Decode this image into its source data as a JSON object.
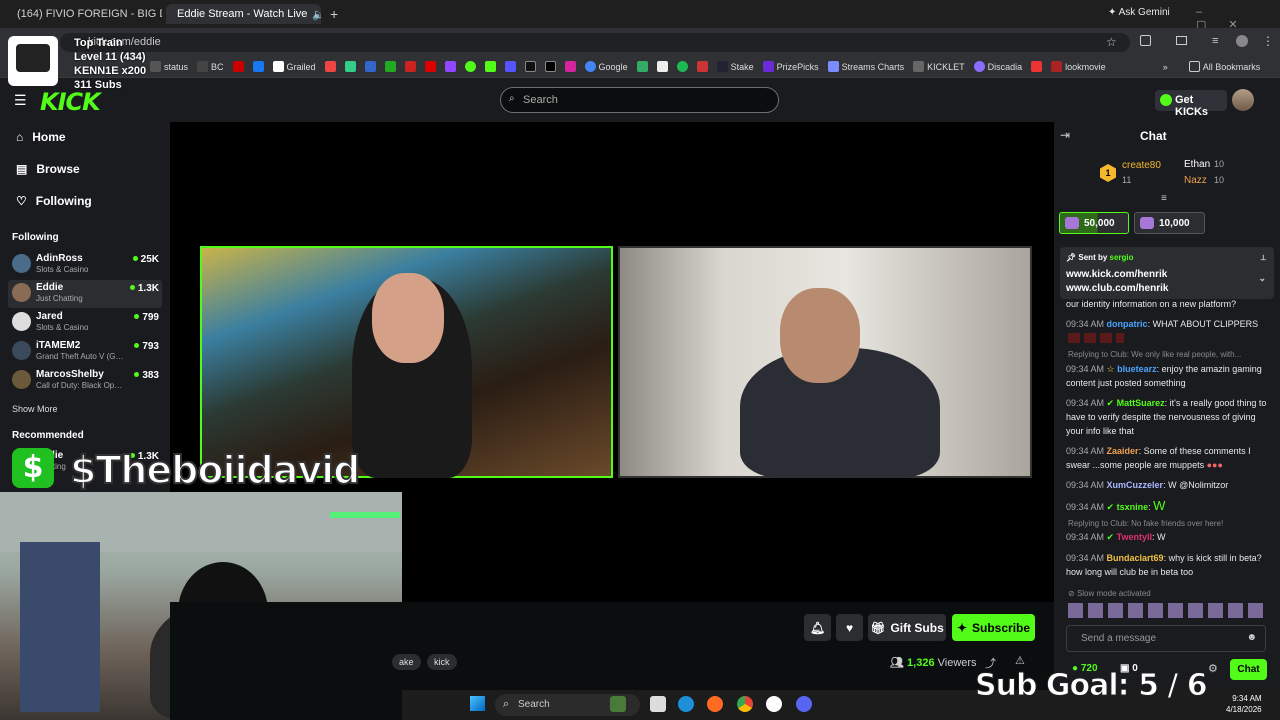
{
  "browser": {
    "tabs": [
      {
        "label": "(164) FIVIO FOREIGN - BIG DRI"
      },
      {
        "label": "Eddie Stream - Watch Live"
      }
    ],
    "ask_gemini": "Ask Gemini",
    "url": "kick.com/eddie",
    "bookmarks": [
      "status",
      "BC",
      "Grailed",
      "Google",
      "Stake",
      "PrizePicks",
      "Streams Charts",
      "KICKLET",
      "Discadia",
      "lookmovie"
    ],
    "all_bookmarks": "All Bookmarks"
  },
  "train": {
    "title": "Top Train",
    "level": "Level 11  (434)",
    "kenn": "KENN1E x200",
    "subs": "311 Subs"
  },
  "header": {
    "logo": "KICK",
    "search_placeholder": "Search",
    "get_kicks": "Get KICKs"
  },
  "sidebar": {
    "nav": [
      {
        "label": "Home"
      },
      {
        "label": "Browse"
      },
      {
        "label": "Following"
      }
    ],
    "following_heading": "Following",
    "following": [
      {
        "name": "AdinRoss",
        "category": "Slots & Casino",
        "viewers": "25K"
      },
      {
        "name": "Eddie",
        "category": "Just Chatting",
        "viewers": "1.3K"
      },
      {
        "name": "Jared",
        "category": "Slots & Casino",
        "viewers": "799"
      },
      {
        "name": "iTAMEM2",
        "category": "Grand Theft Auto V (G…",
        "viewers": "793"
      },
      {
        "name": "MarcosShelby",
        "category": "Call of Duty: Black Op…",
        "viewers": "383"
      }
    ],
    "show_more": "Show More",
    "recommended_heading": "Recommended",
    "recommended": [
      {
        "name": "Eddie",
        "category": "Chatting",
        "viewers": "1.3K"
      }
    ]
  },
  "overlay": {
    "cashtag": "$Theboiidavid",
    "dollar": "$",
    "sub_goal": "Sub Goal:  5 / 6"
  },
  "stream": {
    "gift_subs": "Gift Subs",
    "subscribe": "Subscribe",
    "tags": [
      "ake",
      "kick"
    ],
    "viewers": "1,326",
    "viewers_label": "Viewers"
  },
  "chat": {
    "title": "Chat",
    "leaderboard": {
      "first": "create80",
      "first_count": "11",
      "second": "Ethan",
      "second_count": "10",
      "third": "Nazz",
      "third_count": "10"
    },
    "goals": [
      "50,000",
      "10,000"
    ],
    "pinned": {
      "sent_by": "Sent by",
      "user": "sergio",
      "lines": [
        "www.kick.com/henrik",
        "www.club.com/henrik"
      ]
    },
    "messages": [
      {
        "time": "",
        "user": "",
        "text": "our identity information on a new platform?"
      },
      {
        "time": "09:34 AM",
        "user": "donpatric",
        "text": "WHAT ABOUT CLIPPERS"
      },
      {
        "time": "09:34 AM",
        "user": "bluetearz",
        "text": "enjoy the amazin gaming content just posted something",
        "reply": "Replying to Club: We only like real people, with..."
      },
      {
        "time": "09:34 AM",
        "user": "MattSuarez",
        "text": "it's a really good thing to have to verify despite the nervousness of giving your info like that"
      },
      {
        "time": "09:34 AM",
        "user": "Zaaider",
        "text": "Some of these comments I swear ...some people are muppets"
      },
      {
        "time": "09:34 AM",
        "user": "XumCuzzeler",
        "text": "W @Nolimitzor"
      },
      {
        "time": "09:34 AM",
        "user": "tsxnine",
        "text": ""
      },
      {
        "time": "09:34 AM",
        "user": "Twentyll",
        "text": "W",
        "reply": "Replying to Club: No fake friends over here!"
      },
      {
        "time": "09:34 AM",
        "user": "Bundaclart69",
        "text": "why is kick still in beta? how long will club be in beta too"
      }
    ],
    "slow_mode": "Slow mode activated",
    "send_placeholder": "Send a message",
    "kicks": "720",
    "points": "0",
    "chat_button": "Chat"
  },
  "taskbar": {
    "search": "Search",
    "time": "9:34 AM",
    "date": "4/18/2026"
  },
  "colors": {
    "kick_green": "#53fc18",
    "bg": "#0b0e0f",
    "panel": "#191b1f"
  }
}
